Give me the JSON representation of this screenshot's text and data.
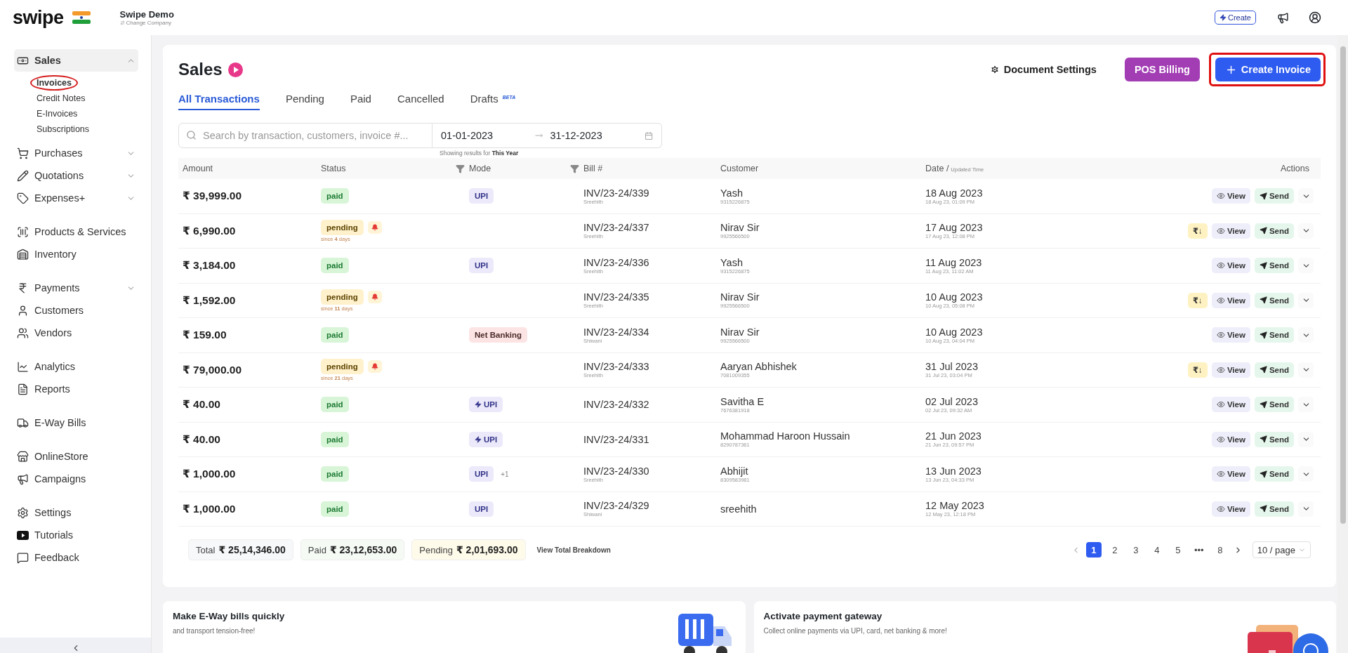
{
  "header": {
    "logo": "swipe",
    "company": "Swipe Demo",
    "change_company": "Change Company",
    "create_button": "Create"
  },
  "sidebar": {
    "sections": [
      {
        "items": [
          {
            "label": "Sales",
            "kind": "group",
            "expanded": true,
            "selected": true,
            "children": [
              {
                "label": "Invoices",
                "selected": true,
                "annotated": true
              },
              {
                "label": "Credit Notes",
                "selected": false,
                "annotated": false
              },
              {
                "label": "E-Invoices",
                "selected": false,
                "annotated": false
              },
              {
                "label": "Subscriptions",
                "selected": false,
                "annotated": false
              }
            ]
          },
          {
            "label": "Purchases",
            "kind": "group",
            "expanded": false,
            "selected": false
          },
          {
            "label": "Quotations",
            "kind": "group",
            "expanded": false,
            "selected": false
          },
          {
            "label": "Expenses+",
            "kind": "group",
            "expanded": false,
            "selected": false
          }
        ]
      },
      {
        "items": [
          {
            "label": "Products & Services",
            "kind": "link",
            "selected": false
          },
          {
            "label": "Inventory",
            "kind": "link",
            "selected": false
          }
        ]
      },
      {
        "items": [
          {
            "label": "Payments",
            "kind": "group",
            "expanded": false,
            "selected": false
          },
          {
            "label": "Customers",
            "kind": "link",
            "selected": false
          },
          {
            "label": "Vendors",
            "kind": "link",
            "selected": false
          }
        ]
      },
      {
        "items": [
          {
            "label": "Analytics",
            "kind": "link",
            "selected": false
          },
          {
            "label": "Reports",
            "kind": "link",
            "selected": false
          }
        ]
      },
      {
        "items": [
          {
            "label": "E-Way Bills",
            "kind": "link",
            "selected": false
          }
        ]
      },
      {
        "items": [
          {
            "label": "OnlineStore",
            "kind": "link",
            "selected": false
          },
          {
            "label": "Campaigns",
            "kind": "link",
            "selected": false
          }
        ]
      },
      {
        "items": [
          {
            "label": "Settings",
            "kind": "link",
            "selected": false
          },
          {
            "label": "Tutorials",
            "kind": "link",
            "selected": false
          },
          {
            "label": "Feedback",
            "kind": "link",
            "selected": false
          }
        ]
      }
    ]
  },
  "page": {
    "title": "Sales",
    "document_settings": "Document Settings",
    "pos_billing": "POS Billing",
    "create_invoice": {
      "label": "Create Invoice",
      "annotated": true
    }
  },
  "tabs": [
    {
      "label": "All Transactions",
      "selected": true
    },
    {
      "label": "Pending",
      "selected": false
    },
    {
      "label": "Paid",
      "selected": false
    },
    {
      "label": "Cancelled",
      "selected": false
    },
    {
      "label": "Drafts",
      "selected": false,
      "badge": "BETA"
    }
  ],
  "filters": {
    "search_placeholder": "Search by transaction, customers, invoice #...",
    "date_from": "01-01-2023",
    "date_to": "31-12-2023",
    "hint": "Showing results for **This Year**"
  },
  "table": {
    "columns": [
      {
        "label": "Amount"
      },
      {
        "label": "Status"
      },
      {
        "label": "Mode",
        "filter": true
      },
      {
        "label": "Bill #",
        "filter": true
      },
      {
        "label": "Customer"
      },
      {
        "label": "Date /",
        "note": "Updated Time"
      },
      {
        "label": "Actions"
      }
    ],
    "rows": [
      {
        "amount": "₹ 39,999.00",
        "status": {
          "kind": "paid",
          "label": "paid"
        },
        "mode": {
          "kind": "upi",
          "label": "UPI",
          "instant": false
        },
        "bill": "INV/23-24/339",
        "bill_by": "Sreehith",
        "customer": "Yash",
        "phone": "9315226875",
        "date": "18 Aug 2023",
        "time": "18 Aug 23, 01:09 PM",
        "view": "View",
        "send": "Send"
      },
      {
        "amount": "₹ 6,990.00",
        "status": {
          "kind": "pending",
          "label": "pending",
          "since": "since **4** days"
        },
        "bill": "INV/23-24/337",
        "bill_by": "Sreehith",
        "customer": "Nirav Sir",
        "phone": "9925566500",
        "date": "17 Aug 2023",
        "time": "17 Aug 23, 12:08 PM",
        "receive": "₹↓",
        "view": "View",
        "send": "Send"
      },
      {
        "amount": "₹ 3,184.00",
        "status": {
          "kind": "paid",
          "label": "paid"
        },
        "mode": {
          "kind": "upi",
          "label": "UPI",
          "instant": false
        },
        "bill": "INV/23-24/336",
        "bill_by": "Sreehith",
        "customer": "Yash",
        "phone": "9315226875",
        "date": "11 Aug 2023",
        "time": "11 Aug 23, 11:02 AM",
        "view": "View",
        "send": "Send"
      },
      {
        "amount": "₹ 1,592.00",
        "status": {
          "kind": "pending",
          "label": "pending",
          "since": "since **11** days"
        },
        "bill": "INV/23-24/335",
        "bill_by": "Sreehith",
        "customer": "Nirav Sir",
        "phone": "9925566500",
        "date": "10 Aug 2023",
        "time": "10 Aug 23, 05:08 PM",
        "receive": "₹↓",
        "view": "View",
        "send": "Send"
      },
      {
        "amount": "₹ 159.00",
        "status": {
          "kind": "paid",
          "label": "paid"
        },
        "mode": {
          "kind": "bank",
          "label": "Net Banking",
          "instant": false
        },
        "bill": "INV/23-24/334",
        "bill_by": "Shiwani",
        "customer": "Nirav Sir",
        "phone": "9925566500",
        "date": "10 Aug 2023",
        "time": "10 Aug 23, 04:04 PM",
        "view": "View",
        "send": "Send"
      },
      {
        "amount": "₹ 79,000.00",
        "status": {
          "kind": "pending",
          "label": "pending",
          "since": "since **21** days"
        },
        "bill": "INV/23-24/333",
        "bill_by": "Sreehith",
        "customer": "Aaryan Abhishek",
        "phone": "7081009355",
        "date": "31 Jul 2023",
        "time": "31 Jul 23, 03:04 PM",
        "receive": "₹↓",
        "view": "View",
        "send": "Send"
      },
      {
        "amount": "₹ 40.00",
        "status": {
          "kind": "paid",
          "label": "paid"
        },
        "mode": {
          "kind": "upi",
          "label": "UPI",
          "instant": true
        },
        "bill": "INV/23-24/332",
        "customer": "Savitha E",
        "phone": "7676381918",
        "date": "02 Jul 2023",
        "time": "02 Jul 23, 09:32 AM",
        "view": "View",
        "send": "Send"
      },
      {
        "amount": "₹ 40.00",
        "status": {
          "kind": "paid",
          "label": "paid"
        },
        "mode": {
          "kind": "upi",
          "label": "UPI",
          "instant": true
        },
        "bill": "INV/23-24/331",
        "customer": "Mohammad Haroon Hussain",
        "phone": "8290787361",
        "date": "21 Jun 2023",
        "time": "21 Jun 23, 09:57 PM",
        "view": "View",
        "send": "Send"
      },
      {
        "amount": "₹ 1,000.00",
        "status": {
          "kind": "paid",
          "label": "paid"
        },
        "mode": {
          "kind": "upi",
          "label": "UPI",
          "instant": false,
          "extra": "+1"
        },
        "bill": "INV/23-24/330",
        "bill_by": "Sreehith",
        "customer": "Abhijit",
        "phone": "8309583981",
        "date": "13 Jun 2023",
        "time": "13 Jun 23, 04:33 PM",
        "view": "View",
        "send": "Send"
      },
      {
        "amount": "₹ 1,000.00",
        "status": {
          "kind": "paid",
          "label": "paid"
        },
        "mode": {
          "kind": "upi",
          "label": "UPI",
          "instant": false
        },
        "bill": "INV/23-24/329",
        "bill_by": "Shiwani",
        "customer": "sreehith",
        "date": "12 May 2023",
        "time": "12 May 23, 12:18 PM",
        "view": "View",
        "send": "Send"
      }
    ]
  },
  "totals": [
    {
      "kind": "total",
      "label": "Total",
      "value": "₹ 25,14,346.00"
    },
    {
      "kind": "paid",
      "label": "Paid",
      "value": "₹ 23,12,653.00"
    },
    {
      "kind": "pending",
      "label": "Pending",
      "value": "₹ 2,01,693.00"
    }
  ],
  "breakdown_link": "View Total Breakdown",
  "pagination": {
    "pages": [
      {
        "label": "1",
        "selected": true
      },
      {
        "label": "2",
        "selected": false
      },
      {
        "label": "3",
        "selected": false
      },
      {
        "label": "4",
        "selected": false
      },
      {
        "label": "5",
        "selected": false
      },
      {
        "label": "•••",
        "selected": false
      },
      {
        "label": "8",
        "selected": false
      }
    ],
    "page_size": "10 / page"
  },
  "promos": [
    {
      "kind": "truck",
      "title": "Make E-Way bills quickly",
      "subtitle": "and transport tension-free!"
    },
    {
      "kind": "card",
      "title": "Activate payment gateway",
      "subtitle": "Collect online payments via UPI, card, net banking & more!"
    }
  ]
}
